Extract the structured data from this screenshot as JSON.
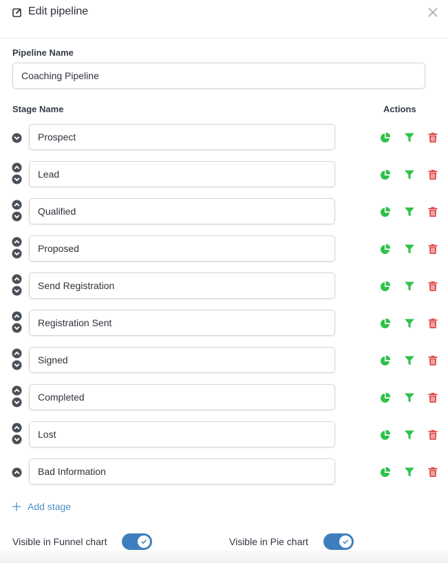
{
  "header": {
    "title": "Edit pipeline",
    "edit_icon": "edit-square-icon",
    "close_icon": "close-icon"
  },
  "pipeline": {
    "label": "Pipeline Name",
    "value": "Coaching Pipeline"
  },
  "stages": {
    "column_stage": "Stage Name",
    "column_actions": "Actions",
    "items": [
      {
        "name": "Prospect",
        "up": false,
        "down": true
      },
      {
        "name": "Lead",
        "up": true,
        "down": true
      },
      {
        "name": "Qualified",
        "up": true,
        "down": true
      },
      {
        "name": "Proposed",
        "up": true,
        "down": true
      },
      {
        "name": "Send Registration",
        "up": true,
        "down": true
      },
      {
        "name": "Registration Sent",
        "up": true,
        "down": true
      },
      {
        "name": "Signed",
        "up": true,
        "down": true
      },
      {
        "name": "Completed",
        "up": true,
        "down": true
      },
      {
        "name": "Lost",
        "up": true,
        "down": true
      },
      {
        "name": "Bad Information",
        "up": true,
        "down": false
      }
    ],
    "action_icons": [
      "pie-chart-icon",
      "funnel-icon",
      "trash-icon"
    ]
  },
  "add_stage": {
    "label": "Add stage"
  },
  "toggles": {
    "funnel": {
      "label": "Visible in Funnel chart",
      "on": true
    },
    "pie": {
      "label": "Visible in Pie chart",
      "on": true
    }
  },
  "colors": {
    "accent_green": "#2ec24a",
    "danger_red": "#e04a4a",
    "toggle_blue": "#3d7fbd",
    "link_blue": "#4a90c8",
    "arrow_gray": "#4a5058"
  }
}
